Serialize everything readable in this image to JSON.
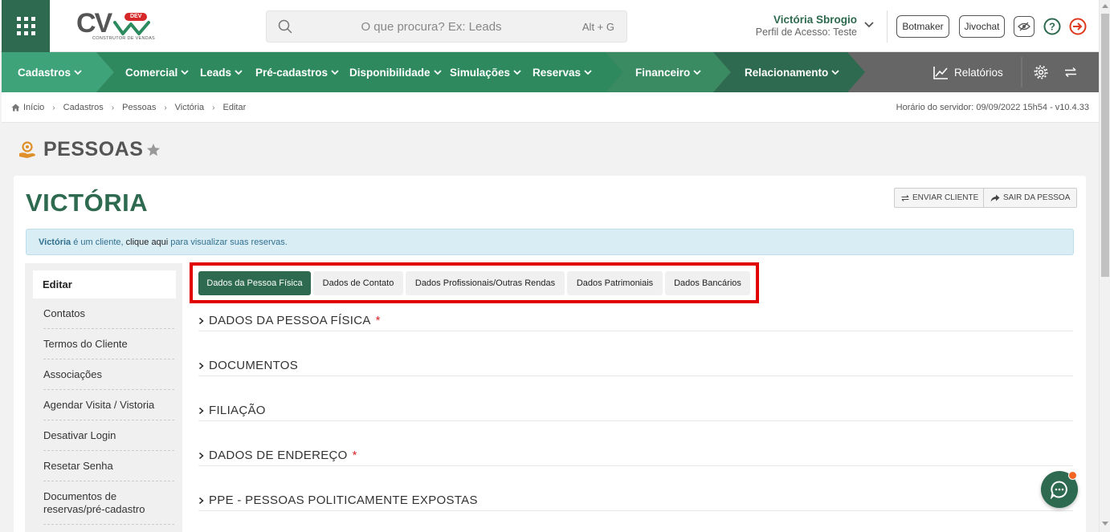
{
  "header": {
    "logo_text": "CV",
    "logo_badge": "DEV",
    "logo_subtitle": "CONSTRUTOR DE VENDAS",
    "search_placeholder": "O que procura? Ex: Leads",
    "search_shortcut": "Alt + G",
    "user_name": "Victória Sbrogio",
    "user_profile": "Perfil de Acesso: Teste",
    "botmaker_label": "Botmaker",
    "jivochat_label": "Jivochat"
  },
  "nav": {
    "items": [
      {
        "label": "Cadastros"
      },
      {
        "label": "Comercial"
      },
      {
        "label": "Leads"
      },
      {
        "label": "Pré-cadastros"
      },
      {
        "label": "Disponibilidade"
      },
      {
        "label": "Simulações"
      },
      {
        "label": "Reservas"
      },
      {
        "label": "Financeiro"
      },
      {
        "label": "Relacionamento"
      }
    ],
    "reports_label": "Relatórios",
    "colors": {
      "cadastros": "#3fa37a",
      "comercial": "#2e8a5e",
      "financeiro": "#3a8a62",
      "relacionamento": "#2d6a4f",
      "rest": "#666666"
    }
  },
  "breadcrumb": {
    "items": [
      "Início",
      "Cadastros",
      "Pessoas",
      "Victória",
      "Editar"
    ],
    "server_time": "Horário do servidor: 09/09/2022 15h54 - v10.4.33"
  },
  "page": {
    "title": "PESSOAS",
    "person_name": "VICTÓRIA",
    "send_client_label": "ENVIAR CLIENTE",
    "leave_person_label": "SAIR DA PESSOA",
    "alert": {
      "name": "Victória",
      "text1": " é um cliente, ",
      "text2": "clique aqui",
      "link": " para visualizar suas reservas."
    }
  },
  "sidebar": {
    "active": "Editar",
    "items": [
      "Contatos",
      "Termos do Cliente",
      "Associações",
      "Agendar Visita / Vistoria",
      "Desativar Login",
      "Resetar Senha",
      "Documentos de reservas/pré-cadastro"
    ]
  },
  "tabs": [
    {
      "label": "Dados da Pessoa Física",
      "active": true
    },
    {
      "label": "Dados de Contato",
      "active": false
    },
    {
      "label": "Dados Profissionais/Outras Rendas",
      "active": false
    },
    {
      "label": "Dados Patrimoniais",
      "active": false
    },
    {
      "label": "Dados Bancários",
      "active": false
    }
  ],
  "sections": [
    {
      "title": "DADOS DA PESSOA FÍSICA",
      "required": true
    },
    {
      "title": "DOCUMENTOS",
      "required": false
    },
    {
      "title": "FILIAÇÃO",
      "required": false
    },
    {
      "title": "DADOS DE ENDEREÇO",
      "required": true
    },
    {
      "title": "PPE - PESSOAS POLITICAMENTE EXPOSTAS",
      "required": false
    }
  ],
  "required_mark": "*",
  "icons": {
    "apps": "grid-icon",
    "search": "search-icon",
    "privacy": "eye-slash-icon",
    "help": "help-icon",
    "logout": "logout-icon",
    "reports": "chart-line-icon",
    "settings": "gear-icon",
    "swap": "swap-icon",
    "chat": "chat-icon"
  }
}
